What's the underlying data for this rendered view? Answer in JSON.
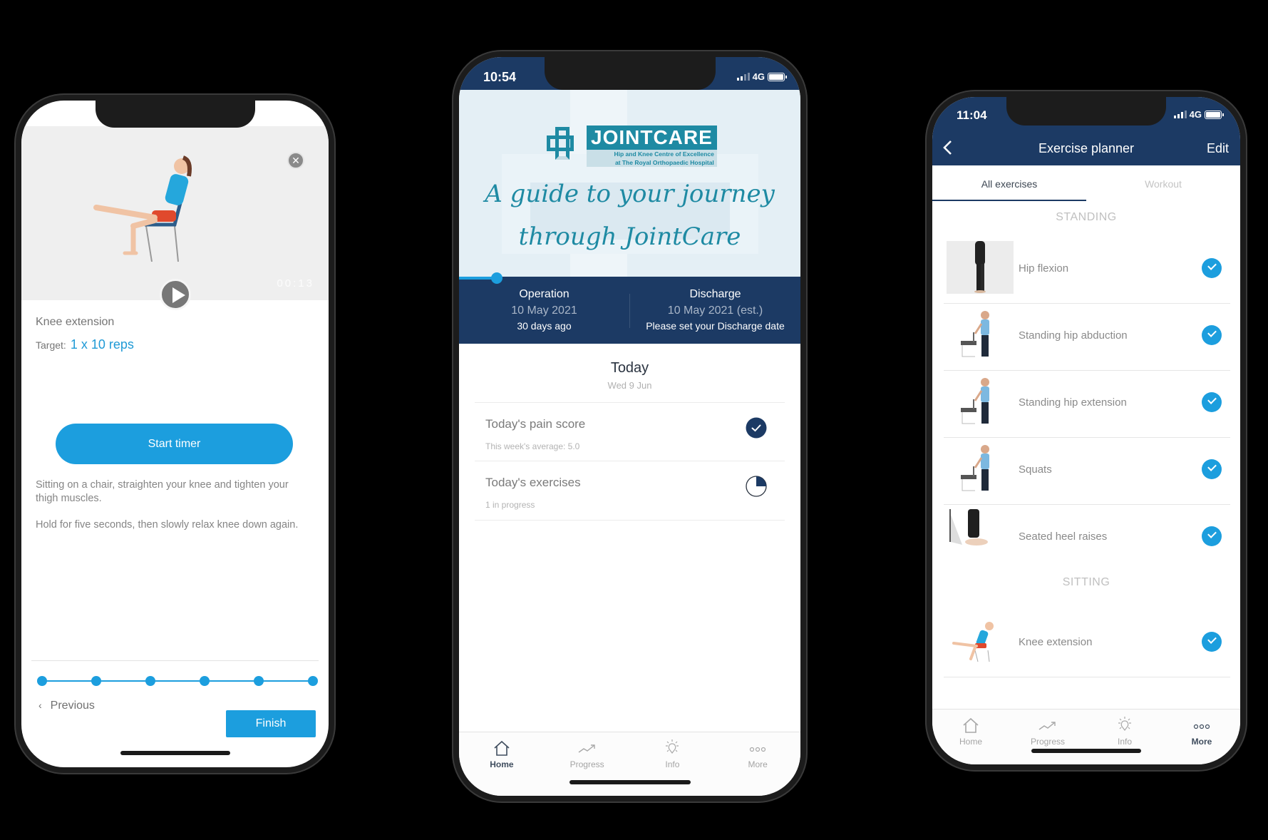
{
  "left_phone": {
    "video": {
      "time": "00:13",
      "close_icon": "close-icon",
      "play_icon": "play-icon"
    },
    "exercise_name": "Knee extension",
    "target_label": "Target:",
    "target_value": "1 x 10 reps",
    "start_timer_label": "Start timer",
    "instructions": [
      "Sitting on a chair, straighten your knee and tighten your thigh muscles.",
      "Hold for five seconds, then slowly relax knee down again."
    ],
    "stepper": {
      "steps": 6,
      "completed": 6
    },
    "previous_label": "Previous",
    "finish_label": "Finish",
    "colors": {
      "accent": "#1c9ede"
    }
  },
  "middle_phone": {
    "status": {
      "time": "10:54",
      "network": "4G"
    },
    "hero": {
      "logo_title": "JOINTCARE",
      "logo_sub1": "Hip and Knee Centre of Excellence",
      "logo_sub2": "at The Royal Orthopaedic Hospital",
      "tagline_1": "A guide to your journey",
      "tagline_2": "through JointCare",
      "journey_progress_fraction": 0.11
    },
    "dates": {
      "operation": {
        "title": "Operation",
        "date": "10 May 2021",
        "note": "30 days ago"
      },
      "discharge": {
        "title": "Discharge",
        "date": "10 May 2021 (est.)",
        "note": "Please set your Discharge date"
      }
    },
    "today": {
      "title": "Today",
      "date": "Wed 9 Jun"
    },
    "cards": [
      {
        "title": "Today's pain score",
        "subtitle": "This week's average: 5.0",
        "status_icon": "check-circle-icon"
      },
      {
        "title": "Today's exercises",
        "subtitle": "1 in progress",
        "status_icon": "pie-progress-icon",
        "progress_fraction": 0.25
      }
    ],
    "tabbar": [
      {
        "label": "Home",
        "icon": "home-icon",
        "active": true
      },
      {
        "label": "Progress",
        "icon": "trend-icon",
        "active": false
      },
      {
        "label": "Info",
        "icon": "lightbulb-icon",
        "active": false
      },
      {
        "label": "More",
        "icon": "more-icon",
        "active": false
      }
    ],
    "colors": {
      "navy": "#1c3a64",
      "teal": "#1e8aa3"
    }
  },
  "right_phone": {
    "status": {
      "time": "11:04",
      "network": "4G"
    },
    "nav": {
      "title": "Exercise planner",
      "edit_label": "Edit",
      "back_icon": "chevron-left-icon"
    },
    "segments": [
      {
        "label": "All exercises",
        "active": true
      },
      {
        "label": "Workout",
        "active": false
      }
    ],
    "sections": [
      {
        "title": "STANDING",
        "items": [
          {
            "name": "Hip flexion",
            "checked": true
          },
          {
            "name": "Standing hip abduction",
            "checked": true
          },
          {
            "name": "Standing hip extension",
            "checked": true
          },
          {
            "name": "Squats",
            "checked": true
          },
          {
            "name": "Seated heel raises",
            "checked": true
          }
        ]
      },
      {
        "title": "SITTING",
        "items": [
          {
            "name": "Knee extension",
            "checked": true
          }
        ]
      }
    ],
    "tabbar": [
      {
        "label": "Home",
        "icon": "home-icon",
        "active": false
      },
      {
        "label": "Progress",
        "icon": "trend-icon",
        "active": false
      },
      {
        "label": "Info",
        "icon": "lightbulb-icon",
        "active": false
      },
      {
        "label": "More",
        "icon": "more-icon",
        "active": true
      }
    ]
  }
}
